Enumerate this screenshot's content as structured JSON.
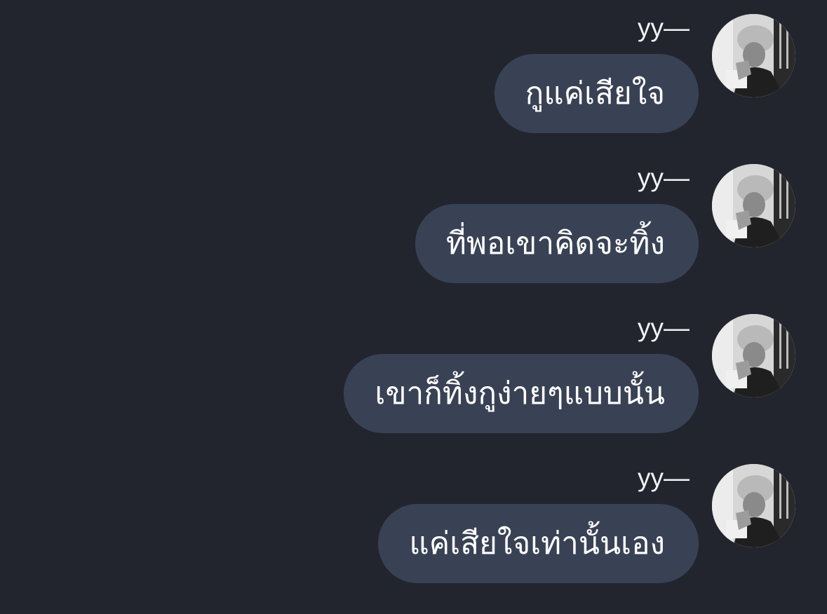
{
  "messages": [
    {
      "sender": "yy—",
      "text": "กูแค่เสียใจ"
    },
    {
      "sender": "yy—",
      "text": "ที่พอเขาคิดจะทิ้ง"
    },
    {
      "sender": "yy—",
      "text": "เขาก็ทิ้งกูง่ายๆแบบนั้น"
    },
    {
      "sender": "yy—",
      "text": "แค่เสียใจเท่านั้นเอง"
    }
  ],
  "colors": {
    "background": "#22252e",
    "bubble": "#394254",
    "text": "#ffffff"
  }
}
